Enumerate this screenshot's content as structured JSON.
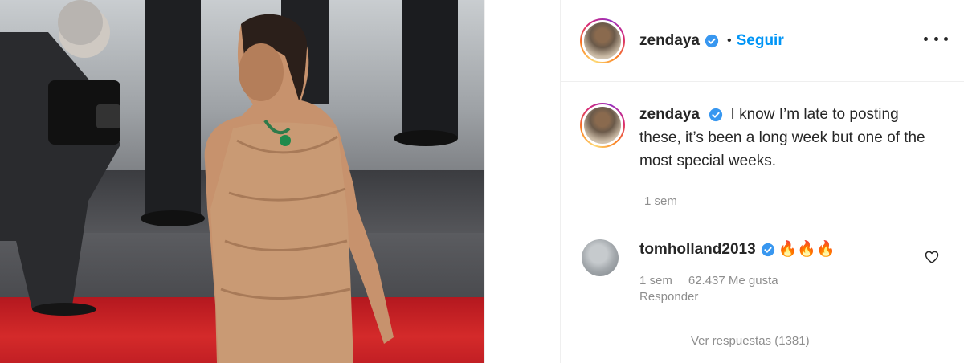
{
  "post": {
    "author": {
      "username": "zendaya",
      "verified": true,
      "follow_label": "Seguir",
      "separator": "•"
    },
    "caption": {
      "username": "zendaya",
      "text": "I know I’m late to posting these, it’s been a long week but one of the most special weeks.",
      "time": "1 sem"
    },
    "comments": [
      {
        "username": "tomholland2013",
        "verified": true,
        "text": "🔥🔥🔥",
        "time": "1 sem",
        "likes": "62.437 Me gusta",
        "reply_label": "Responder",
        "view_replies_label": "Ver respuestas (1381)"
      }
    ],
    "icons": {
      "more": "more-options-icon",
      "verified": "verified-badge-icon",
      "like": "heart-icon"
    },
    "colors": {
      "accent": "#0095f6",
      "text": "#262626",
      "secondary": "#8e8e8e",
      "border": "#efefef",
      "carpet": "#c21f24"
    }
  }
}
